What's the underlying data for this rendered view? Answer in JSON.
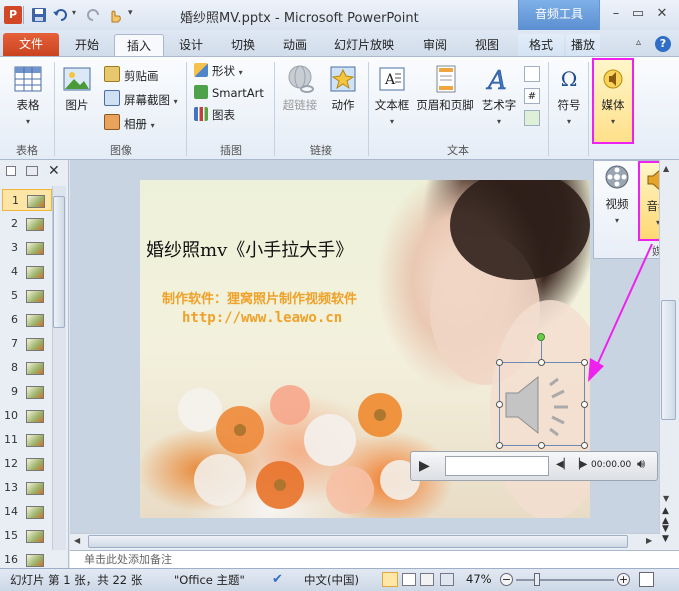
{
  "window": {
    "title": "婚纱照MV.pptx - Microsoft PowerPoint",
    "contextual_tool": "音频工具"
  },
  "tabs": {
    "file": "文件",
    "items": [
      "开始",
      "插入",
      "设计",
      "切换",
      "动画",
      "幻灯片放映",
      "审阅",
      "视图"
    ],
    "context_items": [
      "格式",
      "播放"
    ],
    "active": "插入"
  },
  "ribbon": {
    "table": {
      "label": "表格",
      "group": "表格"
    },
    "image": {
      "group": "图像",
      "picture": "图片",
      "clipart": "剪贴画",
      "screenshot": "屏幕截图",
      "album": "相册"
    },
    "illustrations": {
      "group": "插图",
      "shapes": "形状",
      "smartart": "SmartArt",
      "chart": "图表"
    },
    "links": {
      "group": "链接",
      "hyperlink": "超链接",
      "action": "动作"
    },
    "text": {
      "group": "文本",
      "textbox": "文本框",
      "header_footer": "页眉和页脚",
      "wordart": "艺术字"
    },
    "symbols": {
      "symbol": "符号"
    },
    "media": {
      "label": "媒体"
    }
  },
  "media_flyout": {
    "video": "视频",
    "audio": "音频",
    "group": "媒体"
  },
  "thumbnails": [
    "1",
    "2",
    "3",
    "4",
    "5",
    "6",
    "7",
    "8",
    "9",
    "10",
    "11",
    "12",
    "13",
    "14",
    "15",
    "16"
  ],
  "slide": {
    "title": "婚纱照mv《小手拉大手》",
    "subtitle": "制作软件：狸窝照片制作视频软件",
    "url": "http://www.leawo.cn"
  },
  "player": {
    "time": "00:00.00"
  },
  "notes": {
    "placeholder": "单击此处添加备注"
  },
  "status": {
    "slide_info": "幻灯片 第 1 张，共 22 张",
    "theme": "\"Office 主题\"",
    "language": "中文(中国)",
    "zoom": "47%"
  },
  "colors": {
    "highlight": "#ee22ee",
    "file_tab": "#d5512b",
    "context_tab": "#6a9ad8"
  }
}
